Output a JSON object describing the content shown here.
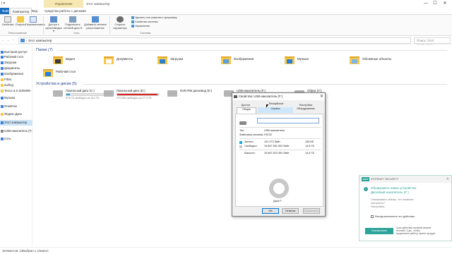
{
  "titlebar": {
    "quick_access": "| ▾",
    "context_tab": "Управление",
    "window_title": "Этот компьютер",
    "min": "—",
    "max": "☐",
    "close": "✕"
  },
  "ribbon_tabs": {
    "file": "Файл",
    "computer": "Компьютер",
    "view": "Вид",
    "drive_tools": "Средства работы с дисками"
  },
  "ribbon": {
    "properties": "Свойства",
    "open": "Открыть",
    "rename": "Переименовать",
    "access_media": "Доступ к мультимедиа ▾",
    "map_drive": "Подключить сетевой диск ▾",
    "add_location": "Добавить сетевое расположение",
    "open_settings": "Открыть параметры",
    "uninstall": "Удалить или изменить программу",
    "system_props": "Свойства системы",
    "manage": "Управление",
    "group_location": "Расположение",
    "group_network": "Сеть",
    "group_system": "Система"
  },
  "addressbar": {
    "back": "←",
    "forward": "→",
    "up": "↑",
    "path": "›  Этот компьютер",
    "search_placeholder": "Поиск: Этот компьютер"
  },
  "navpane": [
    {
      "label": "Быстрый доступ",
      "color": "#3c7fd4"
    },
    {
      "label": "Рабочий стол",
      "color": "#3c7fd4"
    },
    {
      "label": "Загрузки",
      "color": "#3c7fd4"
    },
    {
      "label": "Документы",
      "color": "#3c7fd4"
    },
    {
      "label": "Изображения",
      "color": "#3c7fd4"
    },
    {
      "label": "Films",
      "color": "#f4c84b"
    },
    {
      "label": "surfing",
      "color": "#f4c84b"
    },
    {
      "label": "Тессо-4.2-1108406-",
      "color": "#f4c84b"
    },
    {
      "label": "Музыка",
      "color": "#3c7fd4"
    },
    {
      "label": "OneDrive",
      "color": "#3c7fd4"
    },
    {
      "label": "Яндекс.Диск",
      "color": "#f4c84b"
    },
    {
      "label": "Этот компьютер",
      "color": "#3c7fd4"
    },
    {
      "label": "USB-накопитель (F:)",
      "color": "#888888"
    },
    {
      "label": "Сеть",
      "color": "#3c7fd4"
    }
  ],
  "content": {
    "folders_header": "Папки (7)",
    "drives_header": "Устройства и диски (5)",
    "folders": [
      {
        "name": "Видео",
        "badge": "#3a3a3a"
      },
      {
        "name": "Документы",
        "badge": "#ffffff"
      },
      {
        "name": "Загрузки",
        "badge": "#2c7fd6"
      },
      {
        "name": "Изображения",
        "badge": "#5f9fd9"
      },
      {
        "name": "Музыка",
        "badge": "#2c7fd6"
      },
      {
        "name": "Объемные объекты",
        "badge": "#7fb6e6"
      },
      {
        "name": "Рабочий стол",
        "badge": "#2c7fd6"
      }
    ],
    "drives": [
      {
        "name": "Локальный диск (C:)",
        "free": "573 ГБ свободно из 612 ГБ",
        "used": 0.08,
        "red": false
      },
      {
        "name": "Локальный диск (D:)",
        "free": "370 МБ свободно из 27,9 ГБ",
        "used": 0.99,
        "red": true
      },
      {
        "name": "DVD RW дисковод (E:)",
        "free": "",
        "used": -1,
        "red": false
      },
      {
        "name": "USB-накопитель (F:)",
        "free": "",
        "used": 0.0,
        "red": false
      },
      {
        "name": "Образ (Y:)",
        "free": "",
        "used": -1,
        "red": false
      }
    ]
  },
  "statusbar": {
    "items": "Элементов: 12",
    "selected": "Выбран 1 элемент"
  },
  "dialog": {
    "title": "Свойства: USB-накопитель (F:)",
    "close": "✕",
    "tabs": {
      "access": "Доступ",
      "general": "Общие",
      "readyboost": "ReadyBoost",
      "service": "Сервис",
      "settings": "Настройка",
      "hardware": "Оборудование"
    },
    "type_label": "Тип:",
    "type_value": "USB-накопитель",
    "fs_label": "Файловая система:",
    "fs_value": "FAT32",
    "used_label": "Занято:",
    "used_bytes": "131 072 байт",
    "used_size": "128 КБ",
    "free_label": "Свободно:",
    "free_bytes": "15 667 691 520 байт",
    "free_size": "14,5 ГБ",
    "capacity_label": "Емкость:",
    "capacity_bytes": "15 667 822 592 байт",
    "capacity_size": "14,5 ГБ",
    "disk_label": "Диск F:",
    "ok": "ОК",
    "cancel": "Отмена",
    "apply": "Применить",
    "used_color": "#26a0da",
    "free_color": "#c8c8c8"
  },
  "eset": {
    "brand": "ESET",
    "header": "INTERNET SECURITY",
    "close": "✕",
    "title1": "Обнаружено новое устройство",
    "title2": "Дисковый накопитель (F:)",
    "sub1": "Сканировать сейчас, что позволит",
    "sub2": "настроить?",
    "sub3": "Настройка…",
    "checkbox": "Всегда выполнять это действие",
    "button": "Сканировать",
    "note1": "Срок действия пробной версии",
    "note2": "истекает 2 дн., чтобы",
    "note3": "продолжить работу, купите продукт"
  }
}
